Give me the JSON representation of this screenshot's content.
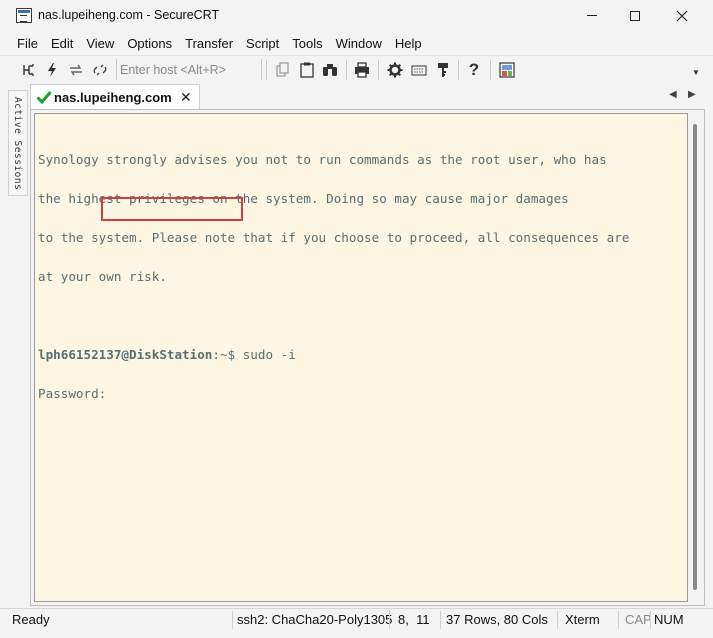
{
  "window": {
    "title": "nas.lupeiheng.com - SecureCRT"
  },
  "menubar": {
    "items": [
      "File",
      "Edit",
      "View",
      "Options",
      "Transfer",
      "Script",
      "Tools",
      "Window",
      "Help"
    ]
  },
  "toolbar": {
    "host_placeholder": "Enter host <Alt+R>",
    "icons": [
      "connect-icon",
      "quick-connect-icon",
      "reconnect-icon",
      "disconnect-icon",
      "copy-icon",
      "paste-icon",
      "find-icon",
      "print-icon",
      "settings-icon",
      "keymap-icon",
      "keygen-icon",
      "help-icon",
      "session-manager-icon"
    ]
  },
  "sidebar": {
    "label": "Active Sessions"
  },
  "tab": {
    "label": "nas.lupeiheng.com",
    "status_color": "#1aa12a"
  },
  "terminal": {
    "lines": [
      "Synology strongly advises you not to run commands as the root user, who has",
      "the highest privileges on the system. Doing so may cause major damages",
      "to the system. Please note that if you choose to proceed, all consequences are",
      "at your own risk."
    ],
    "prompt_user": "lph66152137@DiskStation",
    "prompt_rest": ":~$ sudo -i",
    "password_prompt": "Password:",
    "background": "#fdf6e3",
    "foreground": "#586e75",
    "highlight_color": "#d23f3f"
  },
  "statusbar": {
    "state": "Ready",
    "protocol": "ssh2: ChaCha20-Poly1305",
    "cursor": "8,  11",
    "size": "37 Rows, 80 Cols",
    "terminal_type": "Xterm",
    "caps": "CAP",
    "num": "NUM"
  }
}
